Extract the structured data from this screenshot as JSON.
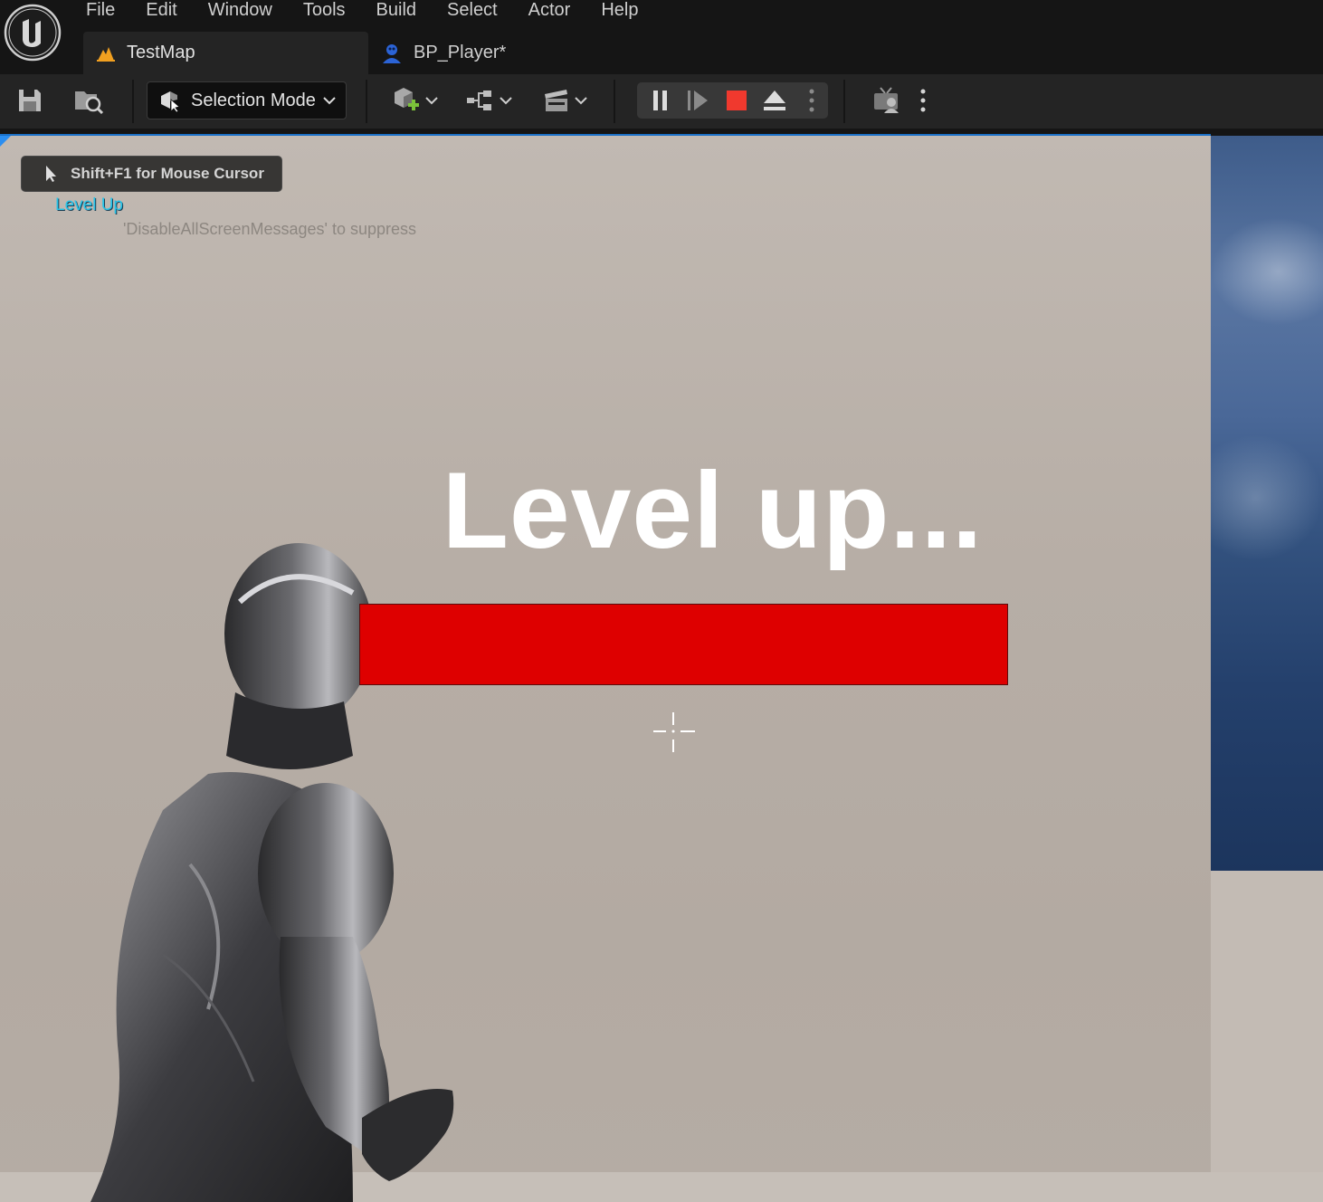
{
  "menu": [
    "File",
    "Edit",
    "Window",
    "Tools",
    "Build",
    "Select",
    "Actor",
    "Help"
  ],
  "tabs": {
    "map_tab": "TestMap",
    "blueprint_tab": "BP_Player*"
  },
  "toolbar": {
    "selection_mode": "Selection Mode"
  },
  "viewport": {
    "mouse_hint": "Shift+F1 for Mouse Cursor",
    "screen_message": "Level Up",
    "suppress_hint": "'DisableAllScreenMessages' to suppress",
    "hud_title": "Level up...",
    "progress": 1.0
  },
  "colors": {
    "progress_fill": "#de0000",
    "message_text": "#27c3e8",
    "accent": "#1a6fc6"
  },
  "icons": [
    "unreal-logo-icon",
    "level-icon",
    "blueprint-user-icon",
    "save-icon",
    "content-browser-icon",
    "selection-mode-icon",
    "add-actor-icon",
    "blueprint-graph-icon",
    "cinematics-icon",
    "pause-icon",
    "step-frame-icon",
    "stop-icon",
    "eject-icon",
    "more-options-icon",
    "platforms-icon",
    "mouse-cursor-icon",
    "crosshair-icon"
  ]
}
